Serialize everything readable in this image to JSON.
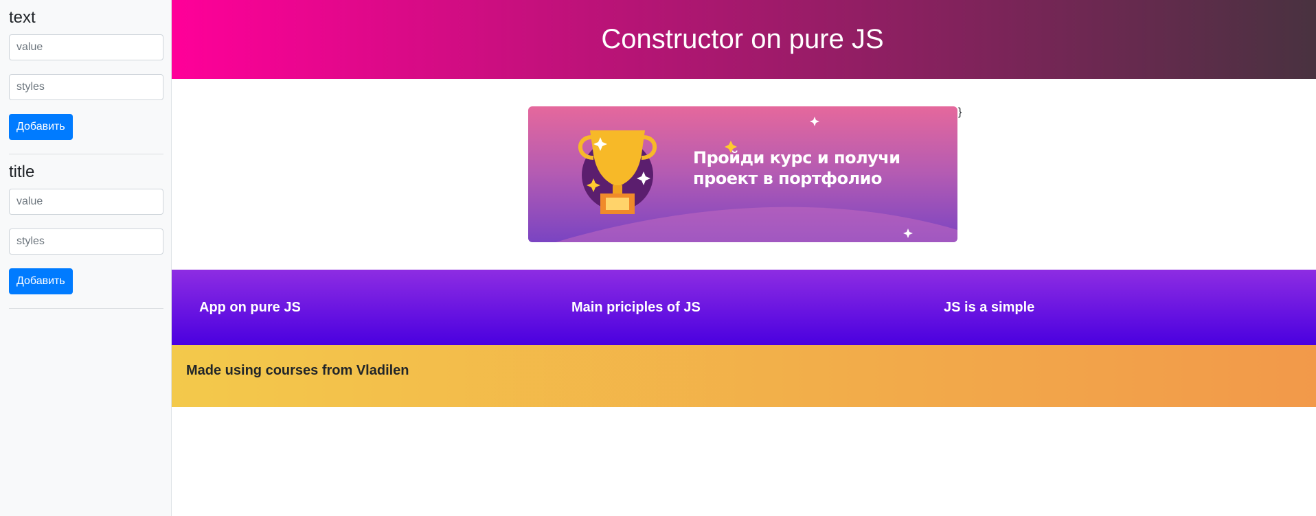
{
  "sidebar": {
    "panels": [
      {
        "title": "text",
        "value_placeholder": "value",
        "styles_placeholder": "styles",
        "button_label": "Добавить"
      },
      {
        "title": "title",
        "value_placeholder": "value",
        "styles_placeholder": "styles",
        "button_label": "Добавить"
      }
    ]
  },
  "header": {
    "title": "Constructor on pure JS"
  },
  "banner": {
    "text_line1": "Пройди курс и получи",
    "text_line2": "проект в портфолио",
    "stray_text": "}"
  },
  "columns": [
    "App on pure JS",
    "Main priciples of JS",
    "JS is a simple"
  ],
  "footer": {
    "text": "Made using courses from Vladilen"
  },
  "colors": {
    "header_gradient": [
      "#ff0099",
      "#493240"
    ],
    "columns_gradient": [
      "#8e2de2",
      "#4a00e0"
    ],
    "footer_gradient": [
      "#f3c94b",
      "#f2994a"
    ],
    "button": "#007bff"
  }
}
